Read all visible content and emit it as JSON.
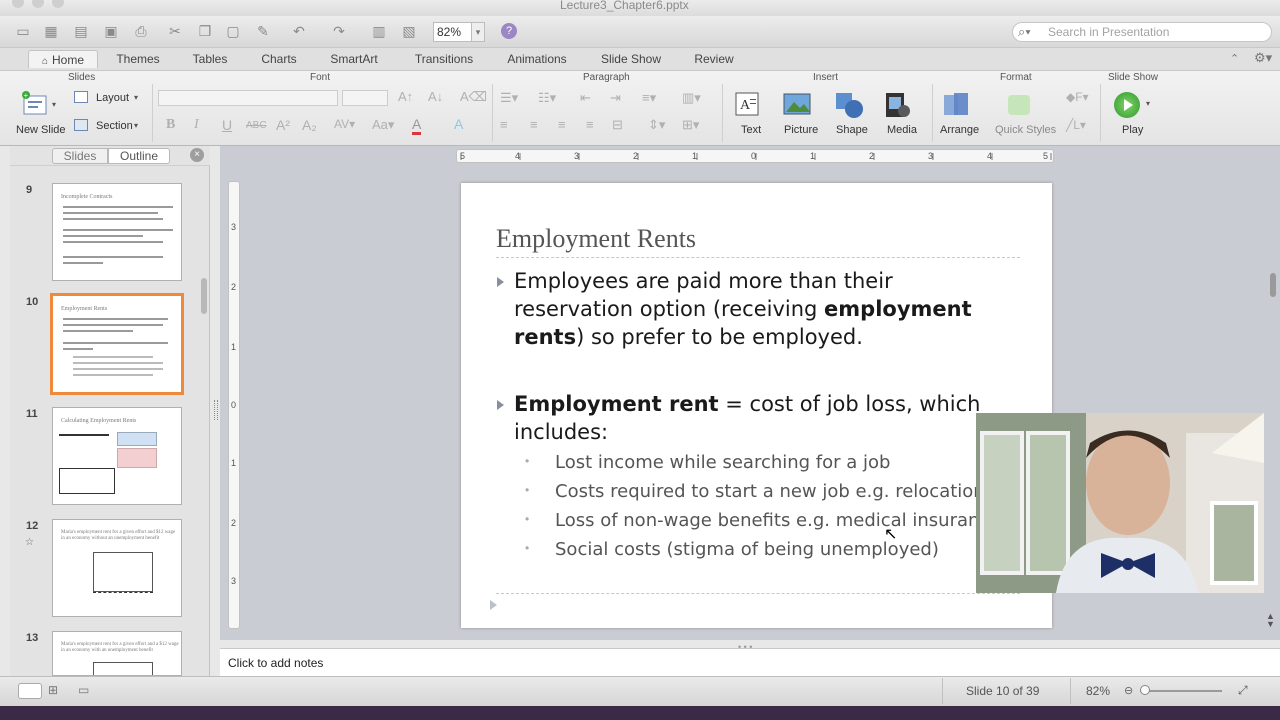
{
  "window": {
    "document_title": "Lecture3_Chapter6.pptx"
  },
  "toolbar": {
    "zoom_value": "82%",
    "search_placeholder": "Search in Presentation"
  },
  "ribbon_tabs": [
    "Home",
    "Themes",
    "Tables",
    "Charts",
    "SmartArt",
    "Transitions",
    "Animations",
    "Slide Show",
    "Review"
  ],
  "ribbon": {
    "groups": {
      "slides": "Slides",
      "font": "Font",
      "paragraph": "Paragraph",
      "insert": "Insert",
      "format": "Format",
      "slide_show": "Slide Show"
    },
    "new_slide": "New Slide",
    "layout": "Layout",
    "section": "Section",
    "insert_buttons": [
      "Text",
      "Picture",
      "Shape",
      "Media"
    ],
    "format_buttons": [
      "Arrange",
      "Quick Styles"
    ],
    "play": "Play"
  },
  "panel": {
    "tab_slides": "Slides",
    "tab_outline": "Outline",
    "close_icon": "×"
  },
  "thumbnails": [
    {
      "number": "9",
      "title": "Incomplete Contracts"
    },
    {
      "number": "10",
      "title": "Employment Rents"
    },
    {
      "number": "11",
      "title": "Calculating Employment Rents"
    },
    {
      "number": "12",
      "title": "Maria's employment rent for a given effort and $12 wage in an economy without an unemployment benefit"
    },
    {
      "number": "13",
      "title": "Maria's employment rent for a given effort and a $12 wage in an economy with an unemployment benefit"
    }
  ],
  "slide": {
    "title": "Employment Rents",
    "bullet1": {
      "part1": "Employees are paid more than their reservation option (receiving ",
      "bold": "employment rents",
      "part2": ") so prefer to be employed."
    },
    "bullet2": {
      "bold": "Employment rent",
      "rest": " = cost of job loss, which includes:"
    },
    "subbullets": [
      "Lost income while searching for a job",
      "Costs required to start a new job e.g. relocation",
      "Loss of non-wage benefits e.g. medical insurance",
      "Social costs (stigma of being unemployed)"
    ],
    "subbullet_marker": "•"
  },
  "notes": {
    "placeholder": "Click to add notes"
  },
  "status": {
    "slide_count": "Slide 10 of 39",
    "zoom": "82%"
  },
  "ruler": {
    "top_ticks": [
      "5",
      "4",
      "3",
      "2",
      "1",
      "0",
      "1",
      "2",
      "3",
      "4",
      "5"
    ],
    "left_ticks": [
      "3",
      "2",
      "1",
      "0",
      "1",
      "2",
      "3"
    ]
  },
  "icons": {
    "search": "search-icon",
    "help": "help-icon",
    "close": "close-icon",
    "play": "play-icon"
  }
}
